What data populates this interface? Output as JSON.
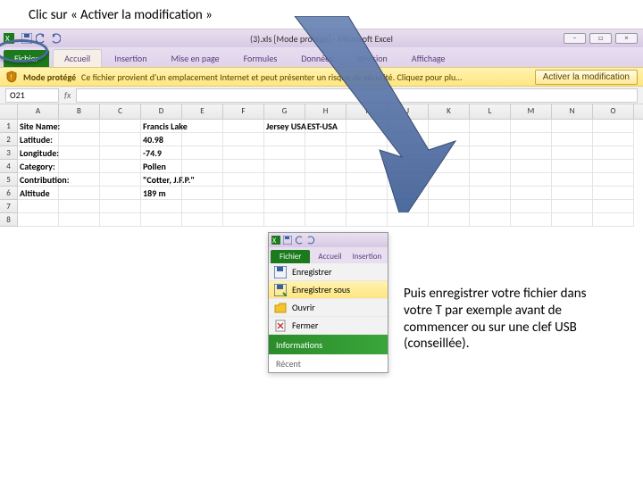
{
  "instructions": {
    "top": "Clic sur « Activer la modification »",
    "right": "Puis enregistrer votre fichier dans votre T par exemple avant de commencer ou sur une clef USB (conseillée)."
  },
  "main_excel": {
    "title_suffix": "(3).xls  [Mode protégé]  -  Microsoft Excel",
    "tabs": {
      "file": "Fichier",
      "home": "Accueil",
      "insert": "Insertion",
      "layout": "Mise en page",
      "formulas": "Formules",
      "data": "Données",
      "review": "Révision",
      "view": "Affichage"
    },
    "protected_view": {
      "label": "Mode protégé",
      "message": "Ce fichier provient d'un emplacement Internet et peut présenter un risque de sécurité. Cliquez pour plus d'infos.",
      "button": "Activer la modification"
    },
    "formula": {
      "cell_ref": "O21",
      "fx": "fx"
    },
    "columns": [
      "A",
      "B",
      "C",
      "D",
      "E",
      "F",
      "G",
      "H",
      "I",
      "J",
      "K",
      "L",
      "M",
      "N",
      "O"
    ],
    "rows": [
      {
        "n": "1",
        "a": "Site Name:",
        "d": "Francis Lake",
        "g": "Jersey USA",
        "h": "EST-USA"
      },
      {
        "n": "2",
        "a": "Latitude:",
        "d": "40.98"
      },
      {
        "n": "3",
        "a": "Longitude:",
        "d": "-74.9"
      },
      {
        "n": "4",
        "a": "Category:",
        "d": "Pollen"
      },
      {
        "n": "5",
        "a": "Contribution:",
        "d": "\"Cotter, J.F.P.\""
      },
      {
        "n": "6",
        "a": "Altitude",
        "d": "189 m"
      },
      {
        "n": "7",
        "a": ""
      },
      {
        "n": "8",
        "a": ""
      }
    ]
  },
  "small_excel": {
    "tabs": {
      "file": "Fichier",
      "home": "Accueil",
      "insert": "Insertion"
    },
    "menu": {
      "save": "Enregistrer",
      "save_as": "Enregistrer sous",
      "open": "Ouvrir",
      "close": "Fermer",
      "info": "Informations",
      "recent": "Récent"
    }
  }
}
